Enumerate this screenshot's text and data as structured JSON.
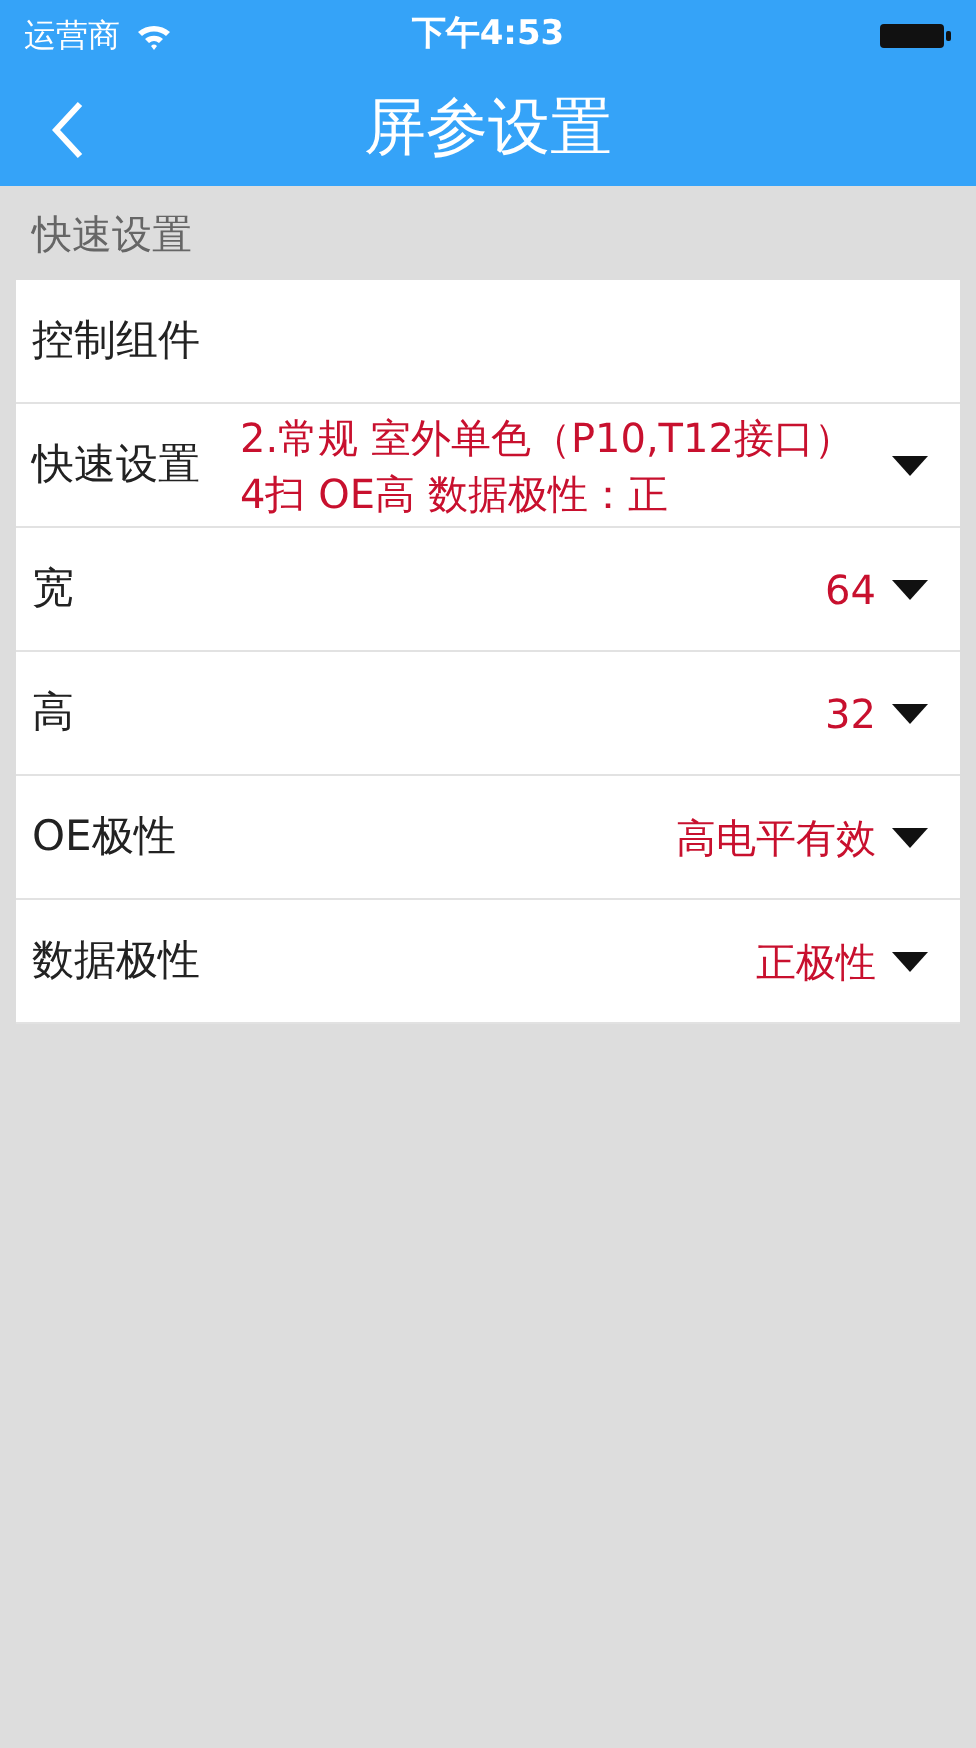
{
  "status_bar": {
    "carrier": "运营商",
    "time": "下午4:53"
  },
  "nav": {
    "title": "屏参设置"
  },
  "section": {
    "title": "快速设置"
  },
  "rows": [
    {
      "kind": "plain",
      "label": "控制组件"
    },
    {
      "kind": "dropdown",
      "label": "快速设置",
      "value": "2.常规 室外单色（P10,T12接口）4扫 OE高 数据极性：正"
    },
    {
      "kind": "dropdown",
      "label": "宽",
      "value": "64"
    },
    {
      "kind": "dropdown",
      "label": "高",
      "value": "32"
    },
    {
      "kind": "dropdown",
      "label": "OE极性",
      "value": "高电平有效"
    },
    {
      "kind": "dropdown",
      "label": "数据极性",
      "value": "正极性"
    }
  ]
}
